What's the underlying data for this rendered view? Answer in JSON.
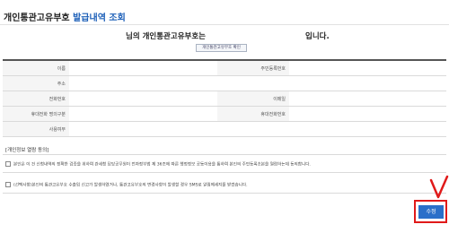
{
  "page": {
    "title_main": "개인통관고유부호",
    "title_sub": "발급내역 조회"
  },
  "header": {
    "left_text": "님의 개인통관고유부호는",
    "right_text": "입니다.",
    "show_button": "개인통관고유부호 확인"
  },
  "form": {
    "rows": [
      {
        "label_left": "이름",
        "value_left": "",
        "label_right": "주민등록번호",
        "value_right": ""
      },
      {
        "label_full": "주소",
        "value_full": ""
      },
      {
        "label_left": "전화번호",
        "value_left": "",
        "label_right": "이메일",
        "value_right": ""
      },
      {
        "label_left": "휴대전화 명의구분",
        "value_left": "",
        "label_right": "휴대전화번호",
        "value_right": ""
      },
      {
        "label_full": "사용여부",
        "value_full": ""
      }
    ]
  },
  "consent": {
    "title": "[개인정보 열람 동의]",
    "item1": "본인은 이 건 신청내역의 정확한 검증을 위하여 관세청 담당공무원이 전자정부법 제 36조에 따른 행정정보 공동이용을 통하여 본인의 주민등록초본을 열람하는데 동의합니다.",
    "item2": "(선택사항)본인의 통관고유부호 수출입 신고가 발생하였거나, 통관고유부호의 변경사항이 발생할 경우 SMS로 알림메세지를 받겠습니다."
  },
  "actions": {
    "submit_label": "수정"
  },
  "colors": {
    "accent": "#2a6fc9",
    "title_blue": "#1c5fb8",
    "highlight_red": "#e01a1a"
  }
}
